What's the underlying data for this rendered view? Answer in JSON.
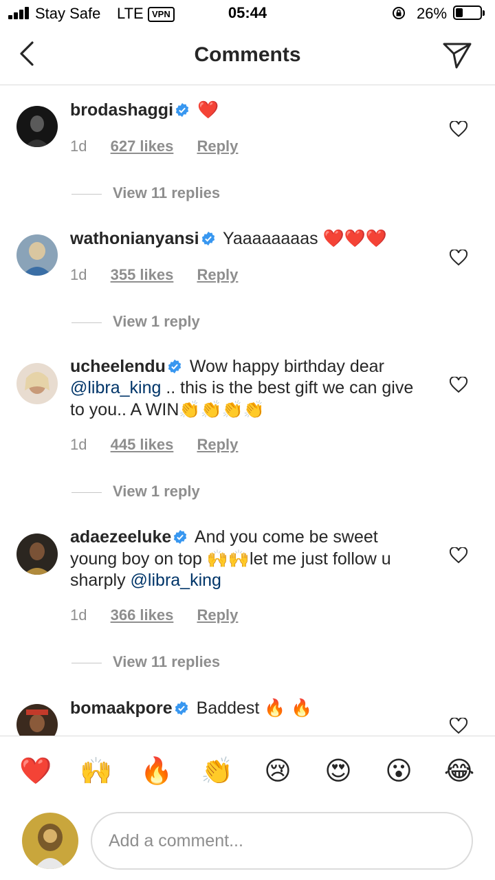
{
  "status_bar": {
    "carrier": "Stay Safe",
    "network": "LTE",
    "vpn": "VPN",
    "time": "05:44",
    "battery": "26%",
    "battery_level": 0.26
  },
  "header": {
    "title": "Comments",
    "back_icon": "chevron-left-icon",
    "share_icon": "paper-plane-icon"
  },
  "comments": [
    {
      "user": "brodashaggi",
      "text": "",
      "emoji": "❤️",
      "time": "1d",
      "likes": "627 likes",
      "reply": "Reply",
      "replies": "View 11 replies"
    },
    {
      "user": "wathonianyansi",
      "text": "Yaaaaaaaas",
      "emoji": "❤️❤️❤️",
      "time": "1d",
      "likes": "355 likes",
      "reply": "Reply",
      "replies": "View 1 reply"
    },
    {
      "user": "ucheelendu",
      "text_before": "Wow happy birthday dear",
      "mention": "@libra_king",
      "text_after": ".. this is the best gift we can give to you.. A WIN",
      "emoji": "👏👏👏👏",
      "time": "1d",
      "likes": "445 likes",
      "reply": "Reply",
      "replies": "View 1 reply"
    },
    {
      "user": "adaezeeluke",
      "text_before": "And you come be sweet young boy on top",
      "emoji": "🙌🙌",
      "text_after": "let me just follow u sharply",
      "mention": "@libra_king",
      "time": "1d",
      "likes": "366 likes",
      "reply": "Reply",
      "replies": "View 11 replies"
    },
    {
      "user": "bomaakpore",
      "text": "Baddest",
      "emoji": "🔥 🔥"
    }
  ],
  "emoji_bar": [
    "❤️",
    "🙌",
    "🔥",
    "👏",
    "😢",
    "😍",
    "😮",
    "😂"
  ],
  "composer": {
    "placeholder": "Add a comment..."
  },
  "colors": {
    "text": "#262626",
    "secondary": "#8e8e8e",
    "verified": "#3897f0",
    "heart": "#ed4956",
    "mention": "#003569"
  }
}
